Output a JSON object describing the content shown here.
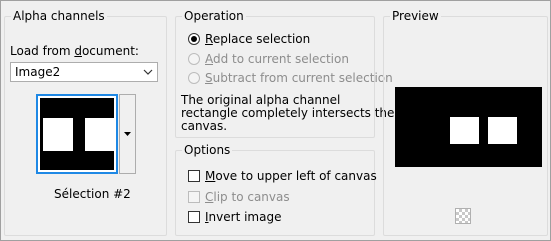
{
  "alpha": {
    "title": "Alpha channels",
    "load_label_pre": "Load from ",
    "load_label_accel": "d",
    "load_label_post": "ocument:",
    "document_value": "Image2",
    "selection_label": "Sélection #2"
  },
  "operation": {
    "title": "Operation",
    "options": [
      {
        "accel": "R",
        "rest": "eplace selection",
        "selected": true,
        "enabled": true
      },
      {
        "accel": "A",
        "rest": "dd to current selection",
        "selected": false,
        "enabled": false
      },
      {
        "accel": "S",
        "rest": "ubtract from current selection",
        "selected": false,
        "enabled": false
      }
    ],
    "info_line1": "The original alpha channel",
    "info_line2": "rectangle completely intersects the",
    "info_line3": "canvas."
  },
  "options": {
    "title": "Options",
    "items": [
      {
        "accel": "M",
        "rest": "ove to upper left of canvas",
        "checked": false,
        "enabled": true
      },
      {
        "accel": "C",
        "rest": "lip to canvas",
        "checked": false,
        "enabled": false
      },
      {
        "accel": "I",
        "rest": "nvert image",
        "checked": false,
        "enabled": true
      }
    ]
  },
  "preview": {
    "title": "Preview"
  }
}
